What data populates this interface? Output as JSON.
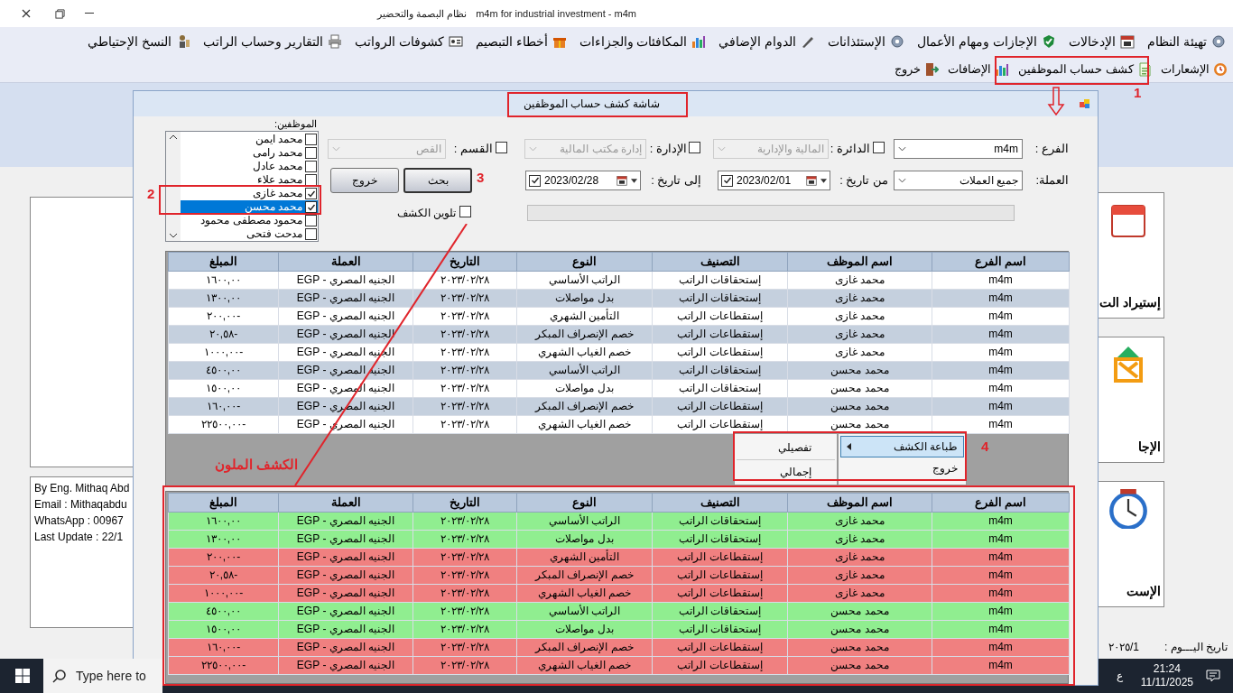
{
  "window": {
    "title": "m4m for industrial investment - m4m",
    "subtitle": "نظام البصمة والتحضير"
  },
  "menu_main": [
    {
      "label": "تهيئة النظام"
    },
    {
      "label": "الإدخالات"
    },
    {
      "label": "الإجازات ومهام الأعمال"
    },
    {
      "label": "الإستئذانات"
    },
    {
      "label": "الدوام الإضافي"
    },
    {
      "label": "المكافئات والجزاءات"
    },
    {
      "label": "أخطاء التبصيم"
    },
    {
      "label": "كشوفات الرواتب"
    },
    {
      "label": "التقارير وحساب الراتب"
    },
    {
      "label": "النسخ الإحتياطي"
    }
  ],
  "menu_secondary": [
    {
      "label": "الإشعارات"
    },
    {
      "label": "كشف حساب الموظفين"
    },
    {
      "label": "الإضافات"
    },
    {
      "label": "خروج"
    }
  ],
  "info_panel": {
    "lines": [
      "By Eng. Mithaq Abd",
      "Email : Mithaqabdu",
      "WhatsApp : 00967",
      "Last Update : 22/1"
    ]
  },
  "tiles": [
    {
      "label": "إستيراد الت"
    },
    {
      "label": "الإجا"
    },
    {
      "label": "الإست"
    }
  ],
  "status_bar": {
    "label": "تاريخ اليـــوم :",
    "value": "1/٢٠٢٥"
  },
  "dialog": {
    "title": "شاشة كشف حساب الموظفين",
    "branch": {
      "label": "الفرع :",
      "value": "m4m"
    },
    "circle": {
      "label": "الدائرة :",
      "checked": false,
      "value": "المالية والإدارية"
    },
    "administration": {
      "label": "الإدارة :",
      "checked": false,
      "value": "إدارة مكتب المالية"
    },
    "section": {
      "label": "القسم :",
      "checked": false,
      "value": "القص"
    },
    "currency": {
      "label": "العملة:",
      "value": "جميع العملات"
    },
    "from_date": {
      "label": "من تاريخ :",
      "checked": true,
      "value": "2023/02/01"
    },
    "to_date": {
      "label": "إلى تاريخ :",
      "checked": true,
      "value": "2023/02/28"
    },
    "buttons": [
      {
        "label": "بحث"
      },
      {
        "label": "خروج"
      }
    ],
    "progress": {
      "level": 0
    },
    "colorize": {
      "label": "تلوين الكشف",
      "checked": false
    },
    "employees": {
      "label": "الموظفين:",
      "items": [
        {
          "name": "محمد ايمن",
          "checked": false,
          "selected": false
        },
        {
          "name": "محمد رامى",
          "checked": false,
          "selected": false
        },
        {
          "name": "محمد عادل",
          "checked": false,
          "selected": false
        },
        {
          "name": "محمد علاء",
          "checked": false,
          "selected": false
        },
        {
          "name": "محمد غازى",
          "checked": true,
          "selected": false
        },
        {
          "name": "محمد محسن",
          "checked": true,
          "selected": true
        },
        {
          "name": "محمود مصطفى محمود",
          "checked": false,
          "selected": false
        },
        {
          "name": "مدحت فتحى",
          "checked": false,
          "selected": false
        }
      ]
    }
  },
  "table": {
    "columns": [
      "اسم الفرع",
      "اسم الموظف",
      "التصنيف",
      "النوع",
      "التاريخ",
      "العملة",
      "المبلغ"
    ],
    "rows": [
      [
        "m4m",
        "محمد غازى",
        "إستحقاقات الراتب",
        "الراتب الأساسي",
        "٢٠٢٣/٠٢/٢٨",
        "الجنيه المصري - EGP",
        "١٦٠٠,٠٠"
      ],
      [
        "m4m",
        "محمد غازى",
        "إستحقاقات الراتب",
        "بدل مواصلات",
        "٢٠٢٣/٠٢/٢٨",
        "الجنيه المصري - EGP",
        "١٣٠٠,٠٠"
      ],
      [
        "m4m",
        "محمد غازى",
        "إستقطاعات الراتب",
        "التأمين الشهري",
        "٢٠٢٣/٠٢/٢٨",
        "الجنيه المصري - EGP",
        "-٢٠٠,٠٠"
      ],
      [
        "m4m",
        "محمد غازى",
        "إستقطاعات الراتب",
        "خصم الإنصراف المبكر",
        "٢٠٢٣/٠٢/٢٨",
        "الجنيه المصري - EGP",
        "-٢٠,٥٨"
      ],
      [
        "m4m",
        "محمد غازى",
        "إستقطاعات الراتب",
        "خصم الغياب الشهري",
        "٢٠٢٣/٠٢/٢٨",
        "الجنيه المصري - EGP",
        "-١٠٠٠,٠٠"
      ],
      [
        "m4m",
        "محمد محسن",
        "إستحقاقات الراتب",
        "الراتب الأساسي",
        "٢٠٢٣/٠٢/٢٨",
        "الجنيه المصري - EGP",
        "٤٥٠٠,٠٠"
      ],
      [
        "m4m",
        "محمد محسن",
        "إستحقاقات الراتب",
        "بدل مواصلات",
        "٢٠٢٣/٠٢/٢٨",
        "الجنيه المصري - EGP",
        "١٥٠٠,٠٠"
      ],
      [
        "m4m",
        "محمد محسن",
        "إستقطاعات الراتب",
        "خصم الإنصراف المبكر",
        "٢٠٢٣/٠٢/٢٨",
        "الجنيه المصري - EGP",
        "-١٦٠,٠٠"
      ],
      [
        "m4m",
        "محمد محسن",
        "إستقطاعات الراتب",
        "خصم الغياب الشهري",
        "٢٠٢٣/٠٢/٢٨",
        "الجنيه المصري - EGP",
        "-٢٢٥٠٠,٠٠"
      ]
    ]
  },
  "colored_table": {
    "columns": [
      "اسم الفرع",
      "اسم الموظف",
      "التصنيف",
      "النوع",
      "التاريخ",
      "العملة",
      "المبلغ"
    ],
    "rows": [
      {
        "color": "#90ee90",
        "cells": [
          "m4m",
          "محمد غازى",
          "إستحقاقات الراتب",
          "الراتب الأساسي",
          "٢٠٢٣/٠٢/٢٨",
          "الجنيه المصري - EGP",
          "١٦٠٠,٠٠"
        ]
      },
      {
        "color": "#90ee90",
        "cells": [
          "m4m",
          "محمد غازى",
          "إستحقاقات الراتب",
          "بدل مواصلات",
          "٢٠٢٣/٠٢/٢٨",
          "الجنيه المصري - EGP",
          "١٣٠٠,٠٠"
        ]
      },
      {
        "color": "#f08080",
        "cells": [
          "m4m",
          "محمد غازى",
          "إستقطاعات الراتب",
          "التأمين الشهري",
          "٢٠٢٣/٠٢/٢٨",
          "الجنيه المصري - EGP",
          "-٢٠٠,٠٠"
        ]
      },
      {
        "color": "#f08080",
        "cells": [
          "m4m",
          "محمد غازى",
          "إستقطاعات الراتب",
          "خصم الإنصراف المبكر",
          "٢٠٢٣/٠٢/٢٨",
          "الجنيه المصري - EGP",
          "-٢٠,٥٨"
        ]
      },
      {
        "color": "#f08080",
        "cells": [
          "m4m",
          "محمد غازى",
          "إستقطاعات الراتب",
          "خصم الغياب الشهري",
          "٢٠٢٣/٠٢/٢٨",
          "الجنيه المصري - EGP",
          "-١٠٠٠,٠٠"
        ]
      },
      {
        "color": "#90ee90",
        "cells": [
          "m4m",
          "محمد محسن",
          "إستحقاقات الراتب",
          "الراتب الأساسي",
          "٢٠٢٣/٠٢/٢٨",
          "الجنيه المصري - EGP",
          "٤٥٠٠,٠٠"
        ]
      },
      {
        "color": "#90ee90",
        "cells": [
          "m4m",
          "محمد محسن",
          "إستحقاقات الراتب",
          "بدل مواصلات",
          "٢٠٢٣/٠٢/٢٨",
          "الجنيه المصري - EGP",
          "١٥٠٠,٠٠"
        ]
      },
      {
        "color": "#f08080",
        "cells": [
          "m4m",
          "محمد محسن",
          "إستقطاعات الراتب",
          "خصم الإنصراف المبكر",
          "٢٠٢٣/٠٢/٢٨",
          "الجنيه المصري - EGP",
          "-١٦٠,٠٠"
        ]
      },
      {
        "color": "#f08080",
        "cells": [
          "m4m",
          "محمد محسن",
          "إستقطاعات الراتب",
          "خصم الغياب الشهري",
          "٢٠٢٣/٠٢/٢٨",
          "الجنيه المصري - EGP",
          "-٢٢٥٠٠,٠٠"
        ]
      }
    ]
  },
  "context_menu": {
    "items": [
      {
        "label": "طباعة الكشف",
        "selected": true
      },
      {
        "label": "خروج",
        "selected": false
      }
    ],
    "submenu": [
      {
        "label": "تفصيلي"
      },
      {
        "label": "إجمالي"
      }
    ]
  },
  "taskbar": {
    "search_placeholder": "Type here to",
    "language": "ع",
    "time": "21:24",
    "date": "11/11/2025"
  },
  "annotations": [
    {
      "label": "1"
    },
    {
      "label": "2"
    },
    {
      "label": "3"
    },
    {
      "label": "4"
    },
    {
      "label": "الكشف الملون"
    }
  ]
}
